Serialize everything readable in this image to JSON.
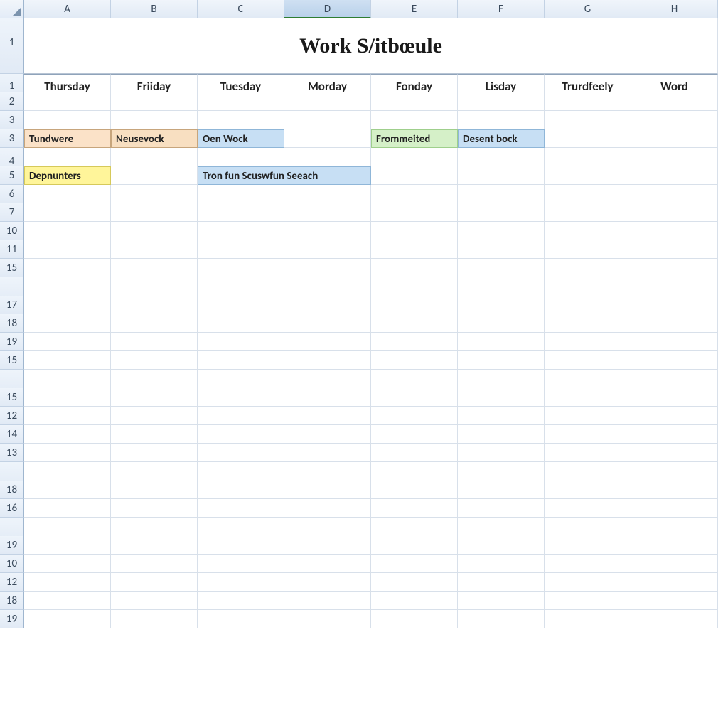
{
  "columns": [
    "A",
    "B",
    "C",
    "D",
    "E",
    "F",
    "G",
    "H"
  ],
  "active_column": "D",
  "row_labels": [
    "1",
    "1",
    "2",
    "3",
    "3",
    "4",
    "5",
    "6",
    "7",
    "10",
    "11",
    "15",
    "",
    "17",
    "18",
    "19",
    "15",
    "",
    "15",
    "12",
    "14",
    "13",
    "",
    "18",
    "16",
    "",
    "19",
    "10",
    "12",
    "18",
    "19"
  ],
  "title": "Work S/itbœule",
  "headers": [
    "Thursday",
    "Friiday",
    "Tuesday",
    "Morday",
    "Fonday",
    "Lisday",
    "Trurdfeely",
    "Word"
  ],
  "cells": {
    "r3": {
      "A": "Tundwere",
      "B": "Neusevock",
      "C": "Oen Wock",
      "E": "Frommeited",
      "F": "Desent bock"
    },
    "r5": {
      "A": "Depnunters",
      "C": "Tron fun Scuswfun Seeach"
    }
  }
}
